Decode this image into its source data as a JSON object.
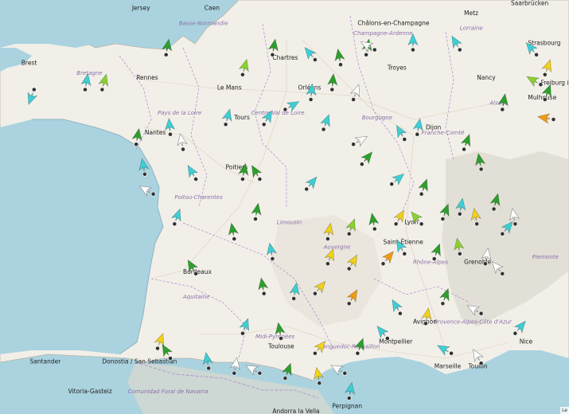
{
  "map": {
    "attribution": "Le",
    "cities": [
      {
        "name": "Jersey"
      },
      {
        "name": "Caen"
      },
      {
        "name": "Brest"
      },
      {
        "name": "Rennes"
      },
      {
        "name": "Le Mans"
      },
      {
        "name": "Chartres"
      },
      {
        "name": "Orléans"
      },
      {
        "name": "Nantes"
      },
      {
        "name": "Tours"
      },
      {
        "name": "Poitiers"
      },
      {
        "name": "Bordeaux"
      },
      {
        "name": "Dijon"
      },
      {
        "name": "Châlons-en-Champagne"
      },
      {
        "name": "Metz"
      },
      {
        "name": "Strasbourg"
      },
      {
        "name": "Saarbrücken"
      },
      {
        "name": "Freiburg im Breisgau"
      },
      {
        "name": "Mulhouse"
      },
      {
        "name": "Lyon"
      },
      {
        "name": "Saint-Étienne"
      },
      {
        "name": "Grenoble"
      },
      {
        "name": "Marseille"
      },
      {
        "name": "Toulouse"
      },
      {
        "name": "Montpellier"
      },
      {
        "name": "Avignon"
      },
      {
        "name": "Nice"
      },
      {
        "name": "Toulon"
      },
      {
        "name": "Perpignan"
      },
      {
        "name": "Santander"
      },
      {
        "name": "Vitoria-Gasteiz"
      },
      {
        "name": "Donostia / San Sebastián"
      },
      {
        "name": "Andorra la Vella"
      },
      {
        "name": "Troyes"
      },
      {
        "name": "Nancy"
      }
    ],
    "regions": [
      {
        "name": "Basse-Normandie"
      },
      {
        "name": "Bretagne"
      },
      {
        "name": "Pays de la Loire"
      },
      {
        "name": "Centre-Val de Loire"
      },
      {
        "name": "Poitou-Charentes"
      },
      {
        "name": "Limousin"
      },
      {
        "name": "Aquitaine"
      },
      {
        "name": "Midi-Pyrénées"
      },
      {
        "name": "Languedoc-Roussillon"
      },
      {
        "name": "Auvergne"
      },
      {
        "name": "Rhône-Alpes"
      },
      {
        "name": "Bourgogne"
      },
      {
        "name": "Franche-Comté"
      },
      {
        "name": "Champagne-Ardenne"
      },
      {
        "name": "Lorraine"
      },
      {
        "name": "Alsace"
      },
      {
        "name": "Provence-Alpes-Côte d'Azur"
      },
      {
        "name": "Comunidad Foral de Navarra"
      },
      {
        "name": "Piemonte"
      }
    ],
    "colors": {
      "sea": "#aad3df",
      "land": "#f2efe9",
      "mountain": "#dcd8cf",
      "green_dark": "#2ca02c",
      "green_light": "#8bd32f",
      "yellow": "#f2d21b",
      "orange": "#f39c12",
      "cyan": "#3cd0d6",
      "white": "#ffffff"
    },
    "wind_markers": [
      {
        "lon": -4.4,
        "lat": 48.6,
        "dir": 200,
        "color": "cyan"
      },
      {
        "lon": -3.2,
        "lat": 48.6,
        "dir": 10,
        "color": "cyan"
      },
      {
        "lon": -2.8,
        "lat": 48.6,
        "dir": 15,
        "color": "green_light"
      },
      {
        "lon": -1.3,
        "lat": 49.3,
        "dir": 10,
        "color": "green_dark"
      },
      {
        "lon": 0.5,
        "lat": 48.9,
        "dir": 15,
        "color": "green_light"
      },
      {
        "lon": 1.2,
        "lat": 49.3,
        "dir": 10,
        "color": "green_dark"
      },
      {
        "lon": 1.5,
        "lat": 48.2,
        "dir": 60,
        "color": "cyan"
      },
      {
        "lon": 2.2,
        "lat": 49.2,
        "dir": 320,
        "color": "cyan"
      },
      {
        "lon": 2.8,
        "lat": 49.1,
        "dir": 350,
        "color": "green_dark"
      },
      {
        "lon": 3.4,
        "lat": 49.3,
        "dir": 10,
        "color": "green_dark"
      },
      {
        "lon": 3.6,
        "lat": 49.4,
        "dir": 300,
        "color": "white"
      },
      {
        "lon": 4.5,
        "lat": 49.4,
        "dir": 0,
        "color": "cyan"
      },
      {
        "lon": 5.6,
        "lat": 49.4,
        "dir": 330,
        "color": "cyan"
      },
      {
        "lon": 2.1,
        "lat": 48.4,
        "dir": 5,
        "color": "cyan"
      },
      {
        "lon": 2.6,
        "lat": 48.6,
        "dir": 5,
        "color": "green_dark"
      },
      {
        "lon": 3.1,
        "lat": 48.4,
        "dir": 20,
        "color": "white"
      },
      {
        "lon": 7.4,
        "lat": 49.3,
        "dir": 320,
        "color": "cyan"
      },
      {
        "lon": 7.6,
        "lat": 48.9,
        "dir": 20,
        "color": "yellow"
      },
      {
        "lon": 7.5,
        "lat": 48.7,
        "dir": 300,
        "color": "green_light"
      },
      {
        "lon": 7.8,
        "lat": 48.0,
        "dir": 280,
        "color": "orange"
      },
      {
        "lon": 7.6,
        "lat": 48.4,
        "dir": 20,
        "color": "green_dark"
      },
      {
        "lon": 6.6,
        "lat": 48.2,
        "dir": 10,
        "color": "green_dark"
      },
      {
        "lon": 0.1,
        "lat": 47.9,
        "dir": 15,
        "color": "cyan"
      },
      {
        "lon": 1.0,
        "lat": 47.9,
        "dir": 30,
        "color": "cyan"
      },
      {
        "lon": -1.2,
        "lat": 47.7,
        "dir": 355,
        "color": "cyan"
      },
      {
        "lon": -0.9,
        "lat": 47.4,
        "dir": 350,
        "color": "white"
      },
      {
        "lon": -2.0,
        "lat": 47.5,
        "dir": 10,
        "color": "green_dark"
      },
      {
        "lon": 2.4,
        "lat": 47.8,
        "dir": 20,
        "color": "cyan"
      },
      {
        "lon": 3.1,
        "lat": 47.5,
        "dir": 60,
        "color": "white"
      },
      {
        "lon": 3.3,
        "lat": 47.1,
        "dir": 40,
        "color": "green_dark"
      },
      {
        "lon": 4.3,
        "lat": 47.6,
        "dir": 330,
        "color": "cyan"
      },
      {
        "lon": 4.6,
        "lat": 47.7,
        "dir": 10,
        "color": "cyan"
      },
      {
        "lon": 5.7,
        "lat": 47.4,
        "dir": 20,
        "color": "green_dark"
      },
      {
        "lon": 6.1,
        "lat": 47.0,
        "dir": 350,
        "color": "green_dark"
      },
      {
        "lon": 0.5,
        "lat": 46.8,
        "dir": 10,
        "color": "green_dark"
      },
      {
        "lon": 0.9,
        "lat": 46.8,
        "dir": 330,
        "color": "green_dark"
      },
      {
        "lon": -1.8,
        "lat": 46.9,
        "dir": 350,
        "color": "cyan"
      },
      {
        "lon": -1.6,
        "lat": 46.5,
        "dir": 300,
        "color": "white"
      },
      {
        "lon": -0.6,
        "lat": 46.8,
        "dir": 330,
        "color": "cyan"
      },
      {
        "lon": 2.0,
        "lat": 46.6,
        "dir": 40,
        "color": "cyan"
      },
      {
        "lon": 4.0,
        "lat": 46.7,
        "dir": 50,
        "color": "cyan"
      },
      {
        "lon": 4.7,
        "lat": 46.5,
        "dir": 20,
        "color": "green_dark"
      },
      {
        "lon": -1.1,
        "lat": 45.9,
        "dir": 20,
        "color": "cyan"
      },
      {
        "lon": 0.8,
        "lat": 46.0,
        "dir": 10,
        "color": "green_dark"
      },
      {
        "lon": 2.5,
        "lat": 45.6,
        "dir": 10,
        "color": "yellow"
      },
      {
        "lon": 3.0,
        "lat": 45.7,
        "dir": 20,
        "color": "green_light"
      },
      {
        "lon": 3.6,
        "lat": 45.8,
        "dir": 350,
        "color": "green_dark"
      },
      {
        "lon": 4.1,
        "lat": 45.9,
        "dir": 30,
        "color": "yellow"
      },
      {
        "lon": 4.7,
        "lat": 45.9,
        "dir": 320,
        "color": "green_light"
      },
      {
        "lon": 5.2,
        "lat": 46.0,
        "dir": 20,
        "color": "green_dark"
      },
      {
        "lon": 5.6,
        "lat": 46.1,
        "dir": 10,
        "color": "cyan"
      },
      {
        "lon": 6.0,
        "lat": 45.9,
        "dir": 350,
        "color": "yellow"
      },
      {
        "lon": 6.4,
        "lat": 46.2,
        "dir": 15,
        "color": "green_dark"
      },
      {
        "lon": 6.6,
        "lat": 45.7,
        "dir": 40,
        "color": "cyan"
      },
      {
        "lon": 6.9,
        "lat": 45.9,
        "dir": 350,
        "color": "white"
      },
      {
        "lon": 0.3,
        "lat": 45.6,
        "dir": 350,
        "color": "green_dark"
      },
      {
        "lon": -0.6,
        "lat": 44.9,
        "dir": 330,
        "color": "green_dark"
      },
      {
        "lon": 1.2,
        "lat": 45.2,
        "dir": 350,
        "color": "cyan"
      },
      {
        "lon": 2.5,
        "lat": 45.1,
        "dir": 20,
        "color": "yellow"
      },
      {
        "lon": 3.0,
        "lat": 45.0,
        "dir": 30,
        "color": "yellow"
      },
      {
        "lon": 3.8,
        "lat": 45.1,
        "dir": 40,
        "color": "orange"
      },
      {
        "lon": 4.3,
        "lat": 45.3,
        "dir": 330,
        "color": "cyan"
      },
      {
        "lon": 5.0,
        "lat": 45.2,
        "dir": 20,
        "color": "green_dark"
      },
      {
        "lon": 5.6,
        "lat": 45.3,
        "dir": 350,
        "color": "green_light"
      },
      {
        "lon": 6.2,
        "lat": 45.1,
        "dir": 10,
        "color": "white"
      },
      {
        "lon": 6.6,
        "lat": 44.9,
        "dir": 320,
        "color": "white"
      },
      {
        "lon": 1.0,
        "lat": 44.5,
        "dir": 350,
        "color": "green_dark"
      },
      {
        "lon": 1.7,
        "lat": 44.4,
        "dir": 10,
        "color": "cyan"
      },
      {
        "lon": 2.2,
        "lat": 44.5,
        "dir": 40,
        "color": "yellow"
      },
      {
        "lon": 3.0,
        "lat": 44.3,
        "dir": 30,
        "color": "orange"
      },
      {
        "lon": 4.2,
        "lat": 44.1,
        "dir": 330,
        "color": "cyan"
      },
      {
        "lon": 5.2,
        "lat": 44.3,
        "dir": 20,
        "color": "green_dark"
      },
      {
        "lon": 6.1,
        "lat": 44.1,
        "dir": 300,
        "color": "white"
      },
      {
        "lon": 6.9,
        "lat": 43.7,
        "dir": 40,
        "color": "cyan"
      },
      {
        "lon": 0.5,
        "lat": 43.7,
        "dir": 20,
        "color": "cyan"
      },
      {
        "lon": 1.4,
        "lat": 43.6,
        "dir": 350,
        "color": "green_dark"
      },
      {
        "lon": 2.2,
        "lat": 43.3,
        "dir": 40,
        "color": "yellow"
      },
      {
        "lon": 3.2,
        "lat": 43.3,
        "dir": 20,
        "color": "green_dark"
      },
      {
        "lon": 3.9,
        "lat": 43.6,
        "dir": 320,
        "color": "cyan"
      },
      {
        "lon": 4.8,
        "lat": 43.9,
        "dir": 10,
        "color": "yellow"
      },
      {
        "lon": 5.4,
        "lat": 43.3,
        "dir": 300,
        "color": "cyan"
      },
      {
        "lon": 6.1,
        "lat": 43.1,
        "dir": 330,
        "color": "white"
      },
      {
        "lon": -1.5,
        "lat": 43.4,
        "dir": 20,
        "color": "yellow"
      },
      {
        "lon": -1.2,
        "lat": 43.2,
        "dir": 330,
        "color": "green_dark"
      },
      {
        "lon": -0.3,
        "lat": 43.0,
        "dir": 350,
        "color": "cyan"
      },
      {
        "lon": 0.3,
        "lat": 42.9,
        "dir": 10,
        "color": "white"
      },
      {
        "lon": 0.9,
        "lat": 42.9,
        "dir": 300,
        "color": "white"
      },
      {
        "lon": 1.5,
        "lat": 42.8,
        "dir": 20,
        "color": "green_dark"
      },
      {
        "lon": 2.3,
        "lat": 42.7,
        "dir": 350,
        "color": "yellow"
      },
      {
        "lon": 2.9,
        "lat": 42.9,
        "dir": 300,
        "color": "white"
      },
      {
        "lon": 3.0,
        "lat": 42.4,
        "dir": 10,
        "color": "cyan"
      }
    ]
  }
}
